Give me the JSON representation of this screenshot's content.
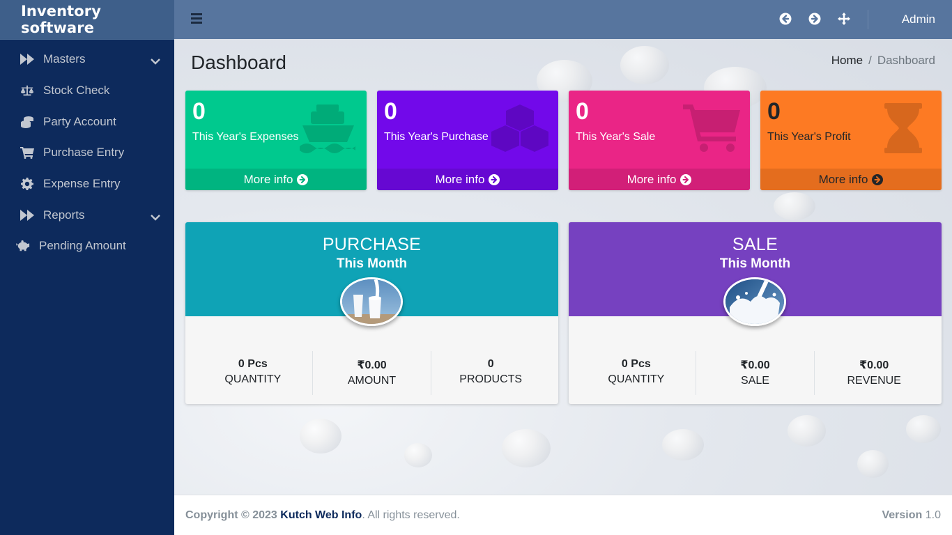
{
  "brand": {
    "title": "Inventory software"
  },
  "sidebar": {
    "items": [
      {
        "label": "Masters",
        "icon": "fast-forward-icon",
        "has_children": true
      },
      {
        "label": "Stock Check",
        "icon": "balance-scale-icon",
        "has_children": false
      },
      {
        "label": "Party Account",
        "icon": "coins-icon",
        "has_children": false
      },
      {
        "label": "Purchase Entry",
        "icon": "cart-icon",
        "has_children": false
      },
      {
        "label": "Expense Entry",
        "icon": "gear-icon",
        "has_children": false
      },
      {
        "label": "Reports",
        "icon": "fast-forward-icon",
        "has_children": true
      },
      {
        "label": "Pending Amount",
        "icon": "piggy-bank-icon",
        "has_children": false
      }
    ]
  },
  "topbar": {
    "icons": [
      "back-arrow-icon",
      "forward-arrow-icon",
      "fullscreen-move-icon"
    ],
    "user": "Admin"
  },
  "page": {
    "title": "Dashboard",
    "breadcrumb": {
      "home": "Home",
      "separator": "/",
      "current": "Dashboard"
    }
  },
  "boxes": [
    {
      "value": "0",
      "label": "This Year's Expenses",
      "more": "More info",
      "color": "#00c98e",
      "footer_color": "#00b480",
      "icon": "ship-icon",
      "text_color": "#ffffff"
    },
    {
      "value": "0",
      "label": "This Year's Purchase",
      "more": "More info",
      "color": "#7209ea",
      "footer_color": "#6608d2",
      "icon": "cubes-icon",
      "text_color": "#ffffff"
    },
    {
      "value": "0",
      "label": "This Year's Sale",
      "more": "More info",
      "color": "#ea2586",
      "footer_color": "#d21f78",
      "icon": "cart-icon",
      "text_color": "#ffffff"
    },
    {
      "value": "0",
      "label": "This Year's Profit",
      "more": "More info",
      "color": "#fd7a23",
      "footer_color": "#e46d1e",
      "icon": "hourglass-icon",
      "text_color": "#212529"
    }
  ],
  "purchase_card": {
    "title": "PURCHASE",
    "subtitle": "This Month",
    "color": "#0fa3b6",
    "stats": [
      {
        "value": "0 Pcs",
        "label": "QUANTITY"
      },
      {
        "value": "₹0.00",
        "label": "AMOUNT"
      },
      {
        "value": "0",
        "label": "PRODUCTS"
      }
    ]
  },
  "sale_card": {
    "title": "SALE",
    "subtitle": "This Month",
    "color": "#7641c0",
    "stats": [
      {
        "value": "0 Pcs",
        "label": "QUANTITY"
      },
      {
        "value": "₹0.00",
        "label": "SALE"
      },
      {
        "value": "₹0.00",
        "label": "REVENUE"
      }
    ]
  },
  "footer": {
    "copyright_prefix": "Copyright © 2023",
    "company": "Kutch Web Info",
    "suffix": ". All rights reserved.",
    "version_label": "Version",
    "version": "1.0"
  }
}
